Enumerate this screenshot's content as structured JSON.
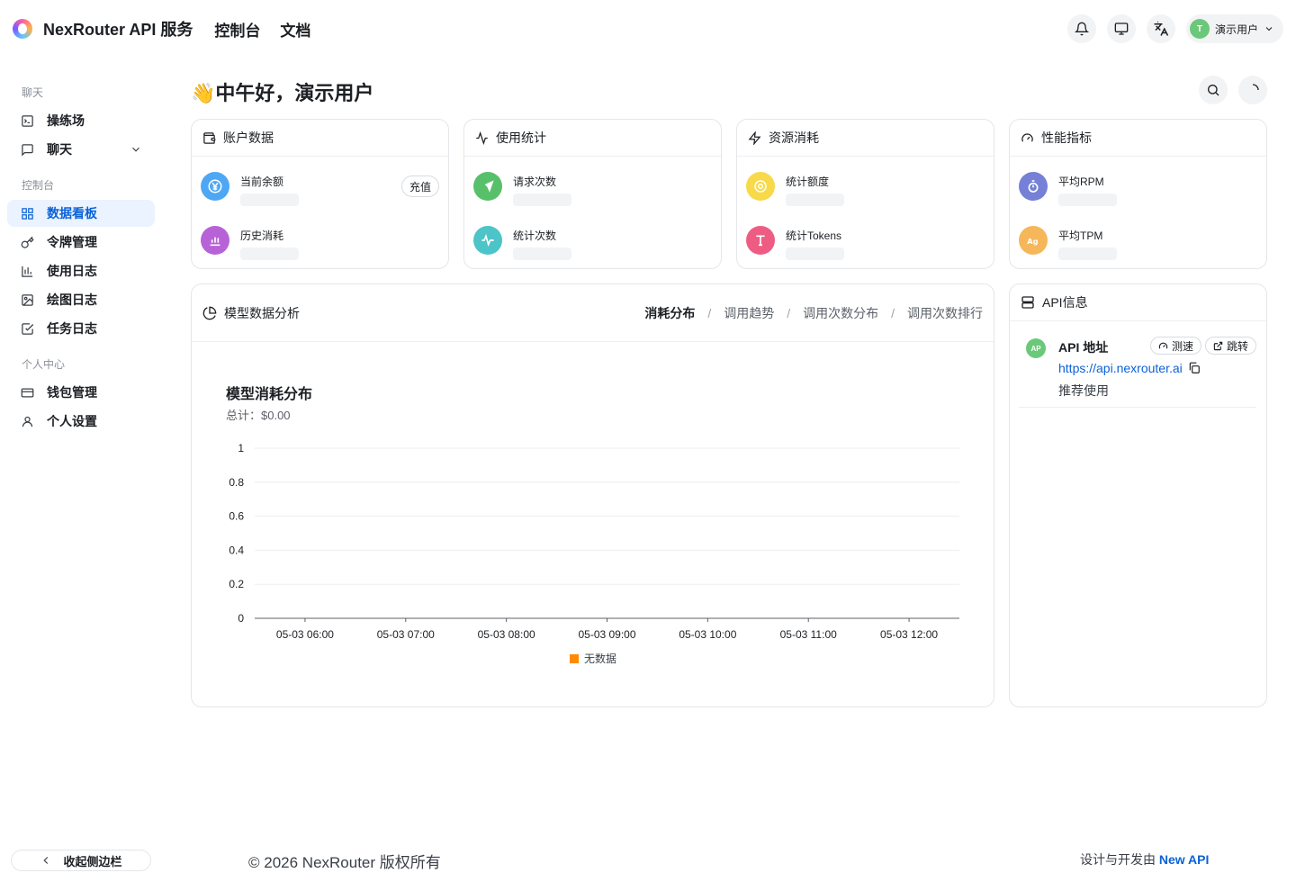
{
  "header": {
    "brand": "NexRouter API 服务",
    "nav": [
      "控制台",
      "文档"
    ],
    "user_name": "演示用户",
    "user_initial": "T"
  },
  "sidebar": {
    "groups": [
      {
        "label": "聊天",
        "items": [
          {
            "label": "操练场",
            "icon": "terminal-icon"
          },
          {
            "label": "聊天",
            "icon": "chat-icon",
            "expandable": true
          }
        ]
      },
      {
        "label": "控制台",
        "items": [
          {
            "label": "数据看板",
            "icon": "dashboard-icon",
            "active": true
          },
          {
            "label": "令牌管理",
            "icon": "key-icon"
          },
          {
            "label": "使用日志",
            "icon": "bar-chart-icon"
          },
          {
            "label": "绘图日志",
            "icon": "image-icon"
          },
          {
            "label": "任务日志",
            "icon": "checkbox-icon"
          }
        ]
      },
      {
        "label": "个人中心",
        "items": [
          {
            "label": "钱包管理",
            "icon": "wallet-icon"
          },
          {
            "label": "个人设置",
            "icon": "user-icon"
          }
        ]
      }
    ],
    "collapse_label": "收起侧边栏"
  },
  "main": {
    "greeting": "👋中午好，演示用户",
    "cards": [
      {
        "title": "账户数据",
        "icon": "wallet-icon",
        "stats": [
          {
            "label": "当前余额",
            "icon": "yen-icon",
            "color": "#4ea7f5"
          },
          {
            "label": "历史消耗",
            "icon": "bar-chart-icon",
            "color": "#b862d8"
          }
        ],
        "action": "充值"
      },
      {
        "title": "使用统计",
        "icon": "activity-icon",
        "stats": [
          {
            "label": "请求次数",
            "icon": "send-icon",
            "color": "#58c06a"
          },
          {
            "label": "统计次数",
            "icon": "pulse-icon",
            "color": "#4cc4c8"
          }
        ]
      },
      {
        "title": "资源消耗",
        "icon": "bolt-icon",
        "stats": [
          {
            "label": "统计额度",
            "icon": "coin-icon",
            "color": "#f7d94a"
          },
          {
            "label": "统计Tokens",
            "icon": "text-icon",
            "color": "#ee5c84"
          }
        ]
      },
      {
        "title": "性能指标",
        "icon": "gauge-icon",
        "stats": [
          {
            "label": "平均RPM",
            "icon": "timer-icon",
            "color": "#7580d6"
          },
          {
            "label": "平均TPM",
            "icon": "ag-icon",
            "color": "#f5b75a"
          }
        ]
      }
    ],
    "chart_panel": {
      "title": "模型数据分析",
      "tabs": [
        "消耗分布",
        "调用趋势",
        "调用次数分布",
        "调用次数排行"
      ],
      "active_tab": "消耗分布",
      "chart_title": "模型消耗分布",
      "chart_total": "总计：$0.00"
    },
    "api_panel": {
      "title": "API信息",
      "avatar": "AP",
      "api_title": "API 地址",
      "speed_label": "测速",
      "jump_label": "跳转",
      "url": "https://api.nexrouter.ai",
      "note": "推荐使用"
    }
  },
  "chart_data": {
    "type": "bar",
    "title": "模型消耗分布",
    "categories": [
      "05-03 06:00",
      "05-03 07:00",
      "05-03 08:00",
      "05-03 09:00",
      "05-03 10:00",
      "05-03 11:00",
      "05-03 12:00"
    ],
    "series": [
      {
        "name": "无数据",
        "values": [
          0,
          0,
          0,
          0,
          0,
          0,
          0
        ],
        "color": "#ff8a00"
      }
    ],
    "yticks": [
      "0",
      "0.2",
      "0.4",
      "0.6",
      "0.8",
      "1"
    ],
    "ylim": [
      0,
      1
    ],
    "grid": true,
    "legend": "bottom"
  },
  "footer": {
    "copyright": "© 2026 NexRouter 版权所有",
    "credit_prefix": "设计与开发由",
    "credit_link": "New API"
  }
}
